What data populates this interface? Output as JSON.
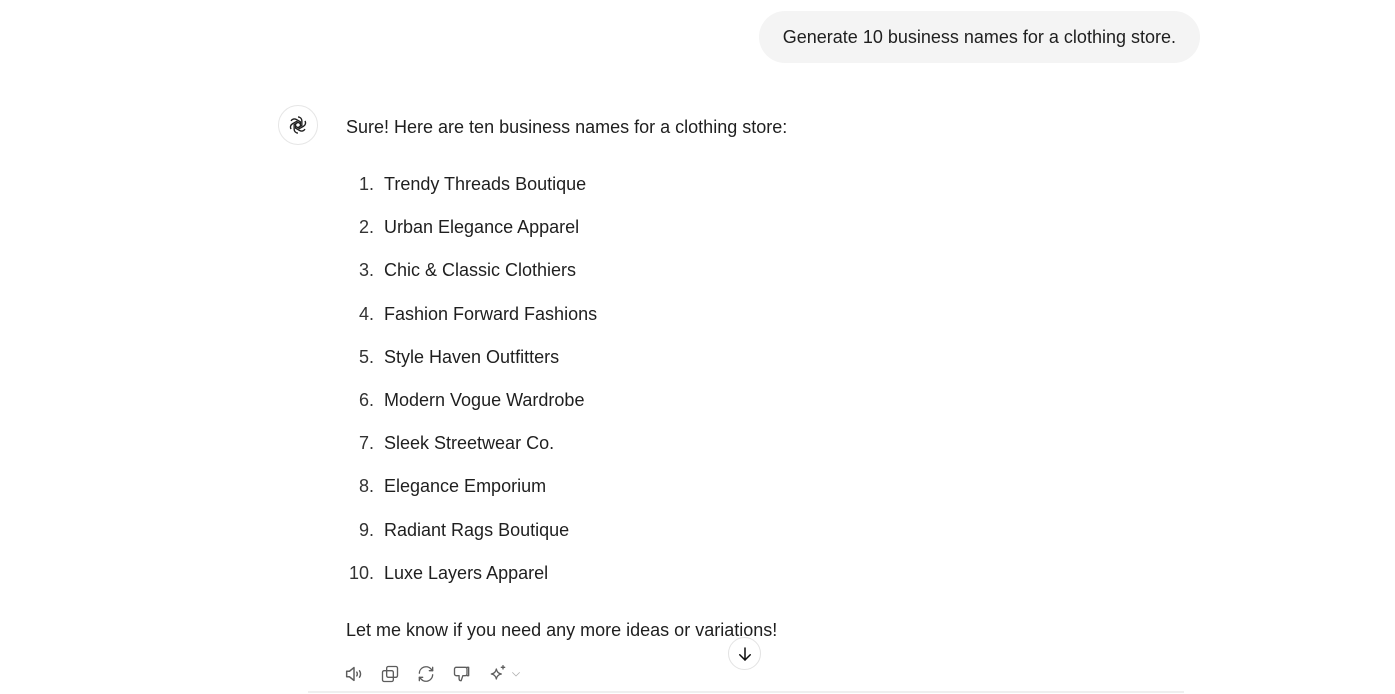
{
  "user_message": "Generate 10 business names for a clothing store.",
  "assistant": {
    "avatar_icon": "openai-logo-icon",
    "intro": "Sure! Here are ten business names for a clothing store:",
    "items": [
      {
        "num": "1.",
        "text": "Trendy Threads Boutique"
      },
      {
        "num": "2.",
        "text": "Urban Elegance Apparel"
      },
      {
        "num": "3.",
        "text": "Chic & Classic Clothiers"
      },
      {
        "num": "4.",
        "text": "Fashion Forward Fashions"
      },
      {
        "num": "5.",
        "text": "Style Haven Outfitters"
      },
      {
        "num": "6.",
        "text": "Modern Vogue Wardrobe"
      },
      {
        "num": "7.",
        "text": "Sleek Streetwear Co."
      },
      {
        "num": "8.",
        "text": "Elegance Emporium"
      },
      {
        "num": "9.",
        "text": "Radiant Rags Boutique"
      },
      {
        "num": "10.",
        "text": "Luxe Layers Apparel"
      }
    ],
    "outro": "Let me know if you need any more ideas or variations!"
  },
  "actions": [
    "read-aloud-icon",
    "copy-icon",
    "regenerate-icon",
    "thumbs-down-icon",
    "sparkle-model-icon"
  ],
  "scroll_button_icon": "arrow-down-icon"
}
